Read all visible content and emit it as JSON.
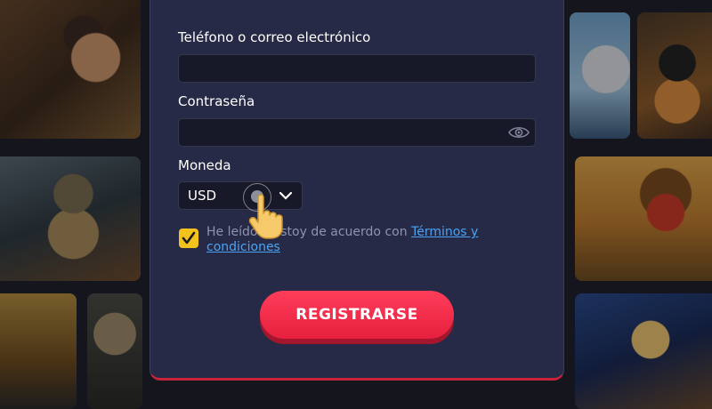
{
  "form": {
    "phone_label": "Teléfono o correo electrónico",
    "phone_value": "",
    "password_label": "Contraseña",
    "password_value": "",
    "currency_label": "Moneda",
    "currency_value": "USD",
    "terms_checked": true,
    "terms_text": "He leído y estoy de acuerdo con ",
    "terms_link": "Términos y condiciones",
    "submit_label": "REGISTRARSE"
  },
  "colors": {
    "panel": "#272a47",
    "input_bg": "#171828",
    "accent": "#ff3d5a",
    "checkbox": "#f4c21c",
    "link": "#4aa3f2"
  },
  "icons": [
    "eye-icon",
    "chevron-down-icon",
    "check-icon",
    "pointer-hand-icon"
  ]
}
